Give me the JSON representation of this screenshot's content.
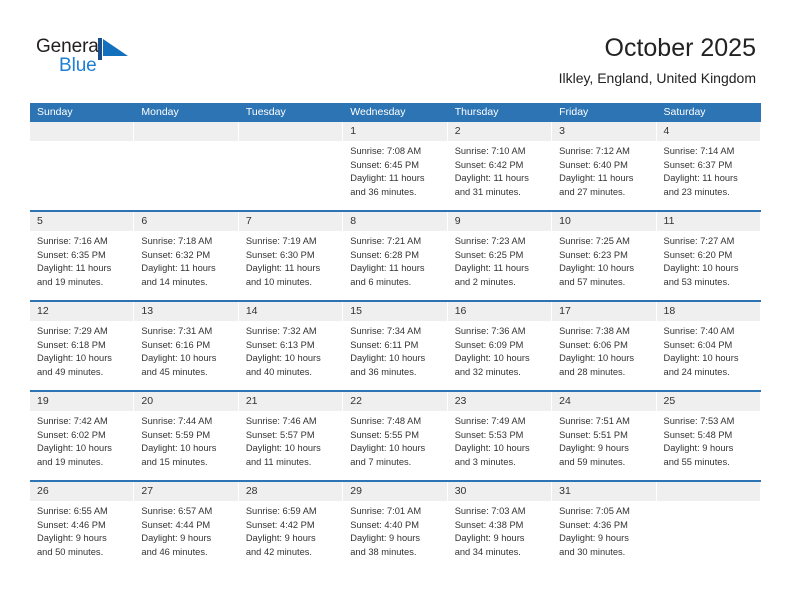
{
  "brand": {
    "name_part1": "General",
    "name_part2": "Blue",
    "logo_icon": "triangle-flag-icon",
    "color_dark": "#231f20",
    "color_blue": "#1e7fd4"
  },
  "header": {
    "title": "October 2025",
    "subtitle": "Ilkley, England, United Kingdom"
  },
  "theme": {
    "header_blue": "#2c74b3",
    "daynum_band": "#efefef",
    "text": "#333333"
  },
  "calendar": {
    "weekdays": [
      "Sunday",
      "Monday",
      "Tuesday",
      "Wednesday",
      "Thursday",
      "Friday",
      "Saturday"
    ],
    "weeks": [
      [
        {
          "day": "",
          "empty": true
        },
        {
          "day": "",
          "empty": true
        },
        {
          "day": "",
          "empty": true
        },
        {
          "day": "1",
          "sunrise": "Sunrise: 7:08 AM",
          "sunset": "Sunset: 6:45 PM",
          "daylight1": "Daylight: 11 hours",
          "daylight2": "and 36 minutes."
        },
        {
          "day": "2",
          "sunrise": "Sunrise: 7:10 AM",
          "sunset": "Sunset: 6:42 PM",
          "daylight1": "Daylight: 11 hours",
          "daylight2": "and 31 minutes."
        },
        {
          "day": "3",
          "sunrise": "Sunrise: 7:12 AM",
          "sunset": "Sunset: 6:40 PM",
          "daylight1": "Daylight: 11 hours",
          "daylight2": "and 27 minutes."
        },
        {
          "day": "4",
          "sunrise": "Sunrise: 7:14 AM",
          "sunset": "Sunset: 6:37 PM",
          "daylight1": "Daylight: 11 hours",
          "daylight2": "and 23 minutes."
        }
      ],
      [
        {
          "day": "5",
          "sunrise": "Sunrise: 7:16 AM",
          "sunset": "Sunset: 6:35 PM",
          "daylight1": "Daylight: 11 hours",
          "daylight2": "and 19 minutes."
        },
        {
          "day": "6",
          "sunrise": "Sunrise: 7:18 AM",
          "sunset": "Sunset: 6:32 PM",
          "daylight1": "Daylight: 11 hours",
          "daylight2": "and 14 minutes."
        },
        {
          "day": "7",
          "sunrise": "Sunrise: 7:19 AM",
          "sunset": "Sunset: 6:30 PM",
          "daylight1": "Daylight: 11 hours",
          "daylight2": "and 10 minutes."
        },
        {
          "day": "8",
          "sunrise": "Sunrise: 7:21 AM",
          "sunset": "Sunset: 6:28 PM",
          "daylight1": "Daylight: 11 hours",
          "daylight2": "and 6 minutes."
        },
        {
          "day": "9",
          "sunrise": "Sunrise: 7:23 AM",
          "sunset": "Sunset: 6:25 PM",
          "daylight1": "Daylight: 11 hours",
          "daylight2": "and 2 minutes."
        },
        {
          "day": "10",
          "sunrise": "Sunrise: 7:25 AM",
          "sunset": "Sunset: 6:23 PM",
          "daylight1": "Daylight: 10 hours",
          "daylight2": "and 57 minutes."
        },
        {
          "day": "11",
          "sunrise": "Sunrise: 7:27 AM",
          "sunset": "Sunset: 6:20 PM",
          "daylight1": "Daylight: 10 hours",
          "daylight2": "and 53 minutes."
        }
      ],
      [
        {
          "day": "12",
          "sunrise": "Sunrise: 7:29 AM",
          "sunset": "Sunset: 6:18 PM",
          "daylight1": "Daylight: 10 hours",
          "daylight2": "and 49 minutes."
        },
        {
          "day": "13",
          "sunrise": "Sunrise: 7:31 AM",
          "sunset": "Sunset: 6:16 PM",
          "daylight1": "Daylight: 10 hours",
          "daylight2": "and 45 minutes."
        },
        {
          "day": "14",
          "sunrise": "Sunrise: 7:32 AM",
          "sunset": "Sunset: 6:13 PM",
          "daylight1": "Daylight: 10 hours",
          "daylight2": "and 40 minutes."
        },
        {
          "day": "15",
          "sunrise": "Sunrise: 7:34 AM",
          "sunset": "Sunset: 6:11 PM",
          "daylight1": "Daylight: 10 hours",
          "daylight2": "and 36 minutes."
        },
        {
          "day": "16",
          "sunrise": "Sunrise: 7:36 AM",
          "sunset": "Sunset: 6:09 PM",
          "daylight1": "Daylight: 10 hours",
          "daylight2": "and 32 minutes."
        },
        {
          "day": "17",
          "sunrise": "Sunrise: 7:38 AM",
          "sunset": "Sunset: 6:06 PM",
          "daylight1": "Daylight: 10 hours",
          "daylight2": "and 28 minutes."
        },
        {
          "day": "18",
          "sunrise": "Sunrise: 7:40 AM",
          "sunset": "Sunset: 6:04 PM",
          "daylight1": "Daylight: 10 hours",
          "daylight2": "and 24 minutes."
        }
      ],
      [
        {
          "day": "19",
          "sunrise": "Sunrise: 7:42 AM",
          "sunset": "Sunset: 6:02 PM",
          "daylight1": "Daylight: 10 hours",
          "daylight2": "and 19 minutes."
        },
        {
          "day": "20",
          "sunrise": "Sunrise: 7:44 AM",
          "sunset": "Sunset: 5:59 PM",
          "daylight1": "Daylight: 10 hours",
          "daylight2": "and 15 minutes."
        },
        {
          "day": "21",
          "sunrise": "Sunrise: 7:46 AM",
          "sunset": "Sunset: 5:57 PM",
          "daylight1": "Daylight: 10 hours",
          "daylight2": "and 11 minutes."
        },
        {
          "day": "22",
          "sunrise": "Sunrise: 7:48 AM",
          "sunset": "Sunset: 5:55 PM",
          "daylight1": "Daylight: 10 hours",
          "daylight2": "and 7 minutes."
        },
        {
          "day": "23",
          "sunrise": "Sunrise: 7:49 AM",
          "sunset": "Sunset: 5:53 PM",
          "daylight1": "Daylight: 10 hours",
          "daylight2": "and 3 minutes."
        },
        {
          "day": "24",
          "sunrise": "Sunrise: 7:51 AM",
          "sunset": "Sunset: 5:51 PM",
          "daylight1": "Daylight: 9 hours",
          "daylight2": "and 59 minutes."
        },
        {
          "day": "25",
          "sunrise": "Sunrise: 7:53 AM",
          "sunset": "Sunset: 5:48 PM",
          "daylight1": "Daylight: 9 hours",
          "daylight2": "and 55 minutes."
        }
      ],
      [
        {
          "day": "26",
          "sunrise": "Sunrise: 6:55 AM",
          "sunset": "Sunset: 4:46 PM",
          "daylight1": "Daylight: 9 hours",
          "daylight2": "and 50 minutes."
        },
        {
          "day": "27",
          "sunrise": "Sunrise: 6:57 AM",
          "sunset": "Sunset: 4:44 PM",
          "daylight1": "Daylight: 9 hours",
          "daylight2": "and 46 minutes."
        },
        {
          "day": "28",
          "sunrise": "Sunrise: 6:59 AM",
          "sunset": "Sunset: 4:42 PM",
          "daylight1": "Daylight: 9 hours",
          "daylight2": "and 42 minutes."
        },
        {
          "day": "29",
          "sunrise": "Sunrise: 7:01 AM",
          "sunset": "Sunset: 4:40 PM",
          "daylight1": "Daylight: 9 hours",
          "daylight2": "and 38 minutes."
        },
        {
          "day": "30",
          "sunrise": "Sunrise: 7:03 AM",
          "sunset": "Sunset: 4:38 PM",
          "daylight1": "Daylight: 9 hours",
          "daylight2": "and 34 minutes."
        },
        {
          "day": "31",
          "sunrise": "Sunrise: 7:05 AM",
          "sunset": "Sunset: 4:36 PM",
          "daylight1": "Daylight: 9 hours",
          "daylight2": "and 30 minutes."
        },
        {
          "day": "",
          "empty": true
        }
      ]
    ]
  }
}
